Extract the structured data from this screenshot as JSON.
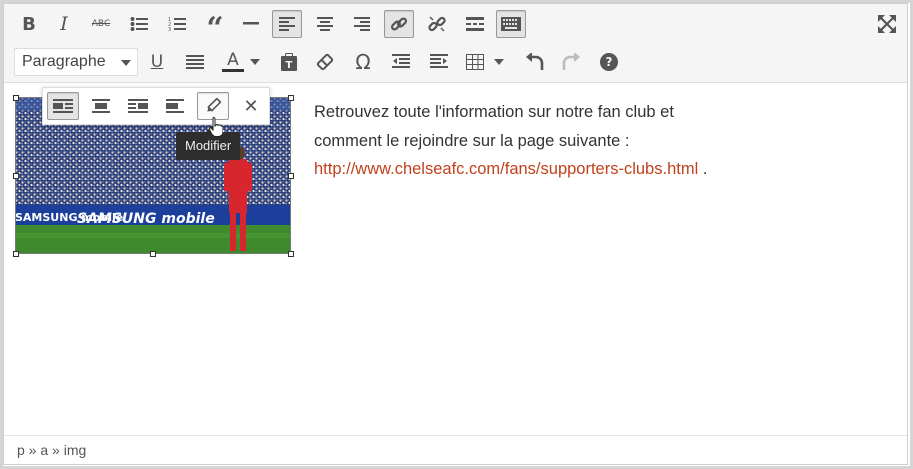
{
  "toolbar": {
    "row1": [
      {
        "name": "bold",
        "label": "B"
      },
      {
        "name": "italic",
        "label": "I"
      },
      {
        "name": "strikethrough",
        "label": "ABC"
      },
      {
        "name": "bullet-list"
      },
      {
        "name": "numbered-list"
      },
      {
        "name": "blockquote"
      },
      {
        "name": "horizontal-line"
      },
      {
        "name": "align-left",
        "active": true
      },
      {
        "name": "align-center"
      },
      {
        "name": "align-right"
      },
      {
        "name": "insert-link",
        "active": true
      },
      {
        "name": "remove-link"
      },
      {
        "name": "read-more"
      },
      {
        "name": "toolbar-toggle",
        "active": true
      },
      {
        "name": "fullscreen"
      }
    ],
    "format_select_value": "Paragraphe",
    "row2": [
      {
        "name": "underline",
        "label": "U"
      },
      {
        "name": "justify"
      },
      {
        "name": "text-color",
        "label": "A"
      },
      {
        "name": "paste-as-text"
      },
      {
        "name": "clear-formatting"
      },
      {
        "name": "special-character",
        "label": "Ω"
      },
      {
        "name": "outdent"
      },
      {
        "name": "indent"
      },
      {
        "name": "table"
      },
      {
        "name": "undo"
      },
      {
        "name": "redo"
      },
      {
        "name": "help",
        "label": "?"
      }
    ]
  },
  "content": {
    "paragraph_text": "Retrouvez toute l'information sur notre fan club et comment le rejoindre sur la page suivante :",
    "link_text": "http://www.chelseafc.com/fans/supporters-clubs.html",
    "trailing_text": " .",
    "image_banner_text": "SAMSUNG mobile"
  },
  "image_toolbar": {
    "buttons": [
      "align-left",
      "align-center",
      "align-right",
      "no-align",
      "edit",
      "remove"
    ],
    "tooltip": "Modifier"
  },
  "statusbar": {
    "path": "p » a » img"
  },
  "colors": {
    "link": "#c1411c",
    "text": "#333333",
    "toolbar_bg": "#f5f5f5"
  }
}
